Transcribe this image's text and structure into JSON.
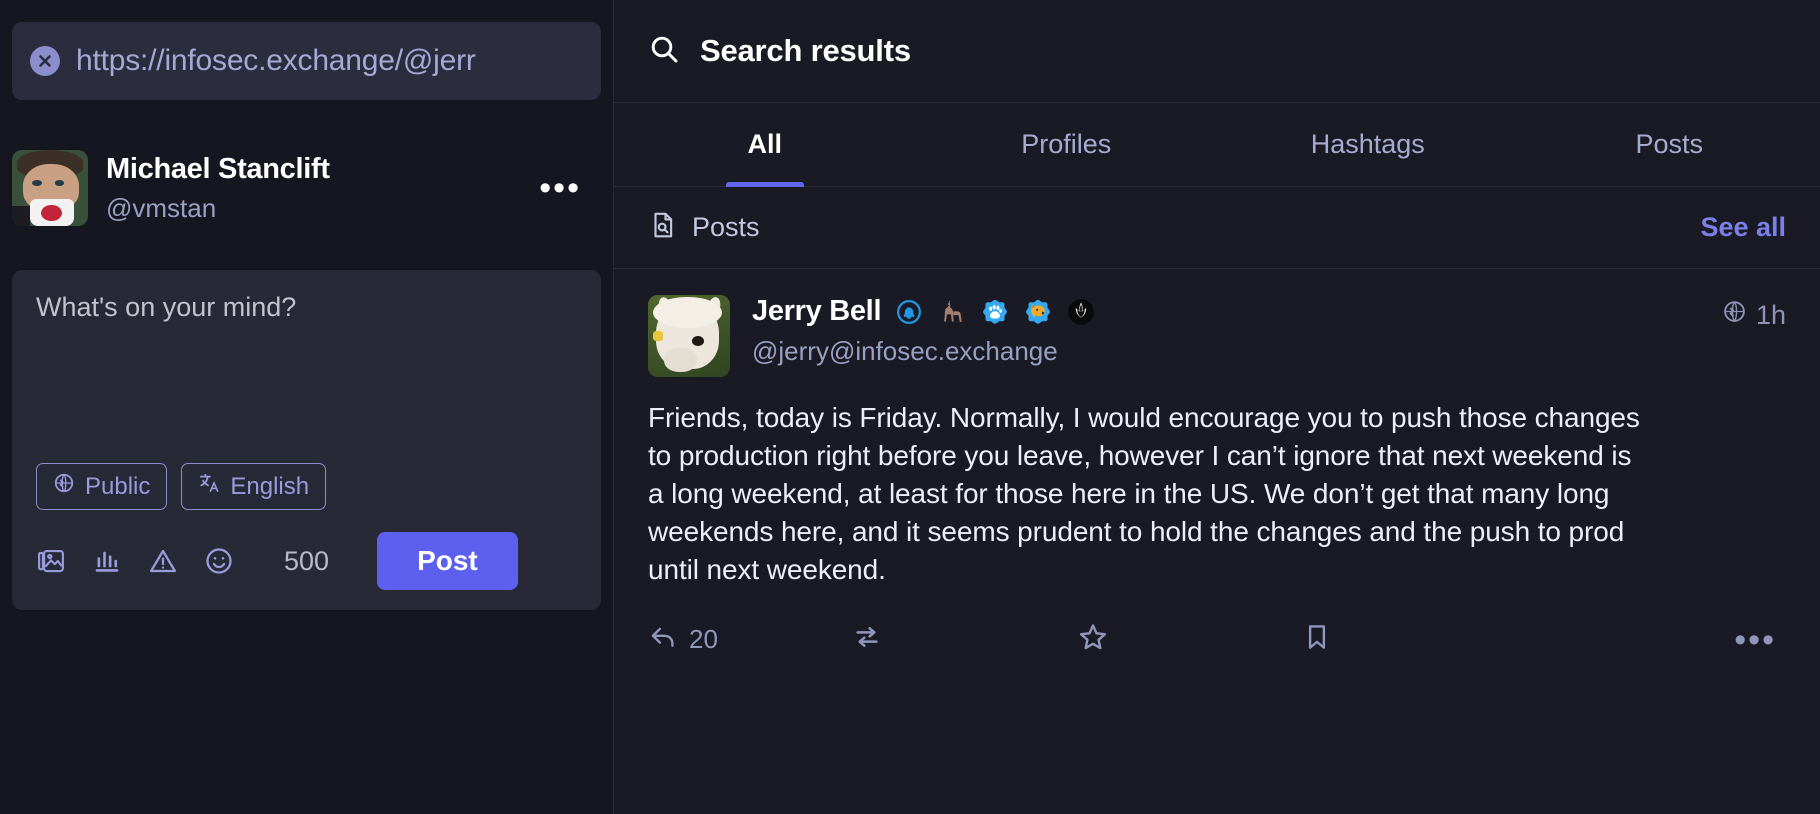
{
  "left": {
    "url_bar": {
      "value": "https://infosec.exchange/@jerr",
      "clear_icon": "close-circle-icon"
    },
    "account": {
      "display_name": "Michael Stanclift",
      "handle": "@vmstan",
      "avatar": "user-avatar",
      "more_label": "•••"
    },
    "composer": {
      "placeholder": "What's on your mind?",
      "value": "",
      "visibility_pill": {
        "icon": "globe-icon",
        "label": "Public"
      },
      "language_pill": {
        "icon": "translate-icon",
        "label": "English"
      },
      "tools": [
        {
          "icon": "image-attachment-icon",
          "label": "Add images"
        },
        {
          "icon": "poll-icon",
          "label": "Add poll"
        },
        {
          "icon": "content-warning-icon",
          "label": "Content warning"
        },
        {
          "icon": "emoji-icon",
          "label": "Insert emoji"
        }
      ],
      "char_count": "500",
      "post_label": "Post"
    }
  },
  "right": {
    "header": {
      "icon": "search-icon",
      "title": "Search results"
    },
    "tabs": [
      {
        "label": "All",
        "active": true
      },
      {
        "label": "Profiles",
        "active": false
      },
      {
        "label": "Hashtags",
        "active": false
      },
      {
        "label": "Posts",
        "active": false
      }
    ],
    "section": {
      "icon": "posts-search-icon",
      "label": "Posts",
      "see_all": "See all"
    },
    "post": {
      "author_name": "Jerry Bell",
      "author_handle": "@jerry@infosec.exchange",
      "avatar": "alpaca-avatar",
      "badges": [
        {
          "name": "bell-emoji",
          "glyph": "🔔"
        },
        {
          "name": "llama-emoji",
          "glyph": "🦙"
        },
        {
          "name": "paw-print-emoji",
          "glyph": "🐾"
        },
        {
          "name": "dog-emoji",
          "glyph": "🐕"
        },
        {
          "name": "rebel-alliance-emoji",
          "glyph": "✪"
        }
      ],
      "visibility_icon": "globe-icon",
      "timestamp": "1h",
      "content": "Friends, today is Friday. Normally, I would encourage you to push those changes to production right before you leave, however I can’t ignore that next weekend is a long weekend, at least for those here in the US. We don’t get that many long weekends here, and it seems prudent to hold the changes and the push to prod until next weekend.",
      "actions": [
        {
          "name": "reply",
          "icon": "reply-icon",
          "count": "20"
        },
        {
          "name": "boost",
          "icon": "boost-icon",
          "count": ""
        },
        {
          "name": "favourite",
          "icon": "star-icon",
          "count": ""
        },
        {
          "name": "bookmark",
          "icon": "bookmark-icon",
          "count": ""
        },
        {
          "name": "more",
          "icon": "more-horizontal-icon",
          "count": ""
        }
      ]
    }
  },
  "colors": {
    "accent": "#6366f1",
    "accent_light": "#9a9bdd",
    "bg": "#15161f",
    "panel": "#191a24",
    "card": "#282937"
  }
}
